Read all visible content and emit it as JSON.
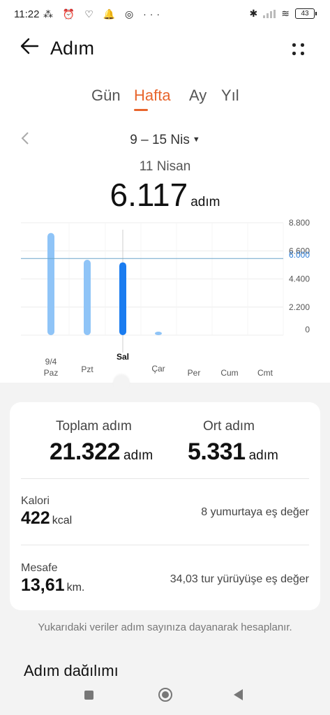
{
  "status_bar": {
    "time": "11:22",
    "left_icons": "⁂ ⏰ ♡ 🔔 ◎ ···",
    "battery": "43"
  },
  "header": {
    "title": "Adım"
  },
  "tabs": [
    {
      "label": "Gün",
      "active": false
    },
    {
      "label": "Hafta",
      "active": true
    },
    {
      "label": "Ay",
      "active": false
    },
    {
      "label": "Yıl",
      "active": false
    }
  ],
  "date": {
    "range": "9 – 15 Nis",
    "selected_day": "11 Nisan"
  },
  "selected": {
    "value": "6.117",
    "unit": "adım"
  },
  "chart_data": {
    "type": "bar",
    "categories": [
      "Paz",
      "Pzt",
      "Sal",
      "Çar",
      "Per",
      "Cum",
      "Cmt"
    ],
    "date_label": "9/4",
    "values": [
      8000,
      5900,
      5700,
      120,
      0,
      0,
      0
    ],
    "selected_index": 2,
    "ylim": [
      0,
      8800
    ],
    "yticks": [
      "8.800",
      "6.600",
      "4.400",
      "2.200",
      "0"
    ],
    "average_line": 6000,
    "average_label": "6.000",
    "colors": {
      "bar": "#8fc4f7",
      "bar_selected": "#1a7cf0",
      "avg_line": "#6aa3c9",
      "avg_label": "#2a7bd6"
    }
  },
  "summary": {
    "total_label": "Toplam adım",
    "total_value": "21.322",
    "total_unit": "adım",
    "avg_label": "Ort adım",
    "avg_value": "5.331",
    "avg_unit": "adım",
    "calorie_label": "Kalori",
    "calorie_value": "422",
    "calorie_unit": "kcal",
    "calorie_equiv": "8 yumurtaya eş değer",
    "distance_label": "Mesafe",
    "distance_value": "13,61",
    "distance_unit": "km.",
    "distance_equiv": "34,03 tur yürüyüşe eş değer"
  },
  "note": "Yukarıdaki veriler adım sayınıza dayanarak hesaplanır.",
  "section_title": "Adım dağılımı"
}
